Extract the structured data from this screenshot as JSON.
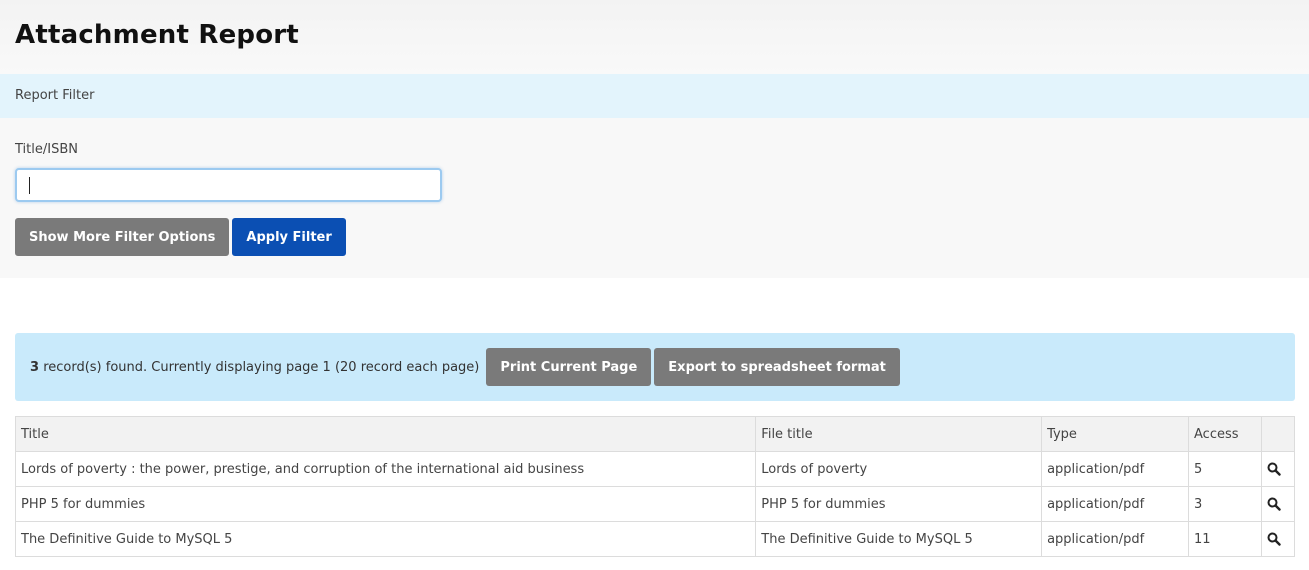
{
  "page": {
    "title": "Attachment Report"
  },
  "filter": {
    "section_label": "Report Filter",
    "field_label": "Title/ISBN",
    "field_value": "",
    "more_options_label": "Show More Filter Options",
    "apply_label": "Apply Filter"
  },
  "results": {
    "count": "3",
    "message": "record(s) found. Currently displaying page 1 (20 record each page)",
    "print_label": "Print Current Page",
    "export_label": "Export to spreadsheet format"
  },
  "table": {
    "headers": [
      "Title",
      "File title",
      "Type",
      "Access",
      ""
    ],
    "rows": [
      {
        "title": "Lords of poverty : the power, prestige, and corruption of the international aid business",
        "file_title": "Lords of poverty",
        "type": "application/pdf",
        "access": "5",
        "action_icon": "search-icon"
      },
      {
        "title": "PHP 5 for dummies",
        "file_title": "PHP 5 for dummies",
        "type": "application/pdf",
        "access": "3",
        "action_icon": "search-icon"
      },
      {
        "title": "The Definitive Guide to MySQL 5",
        "file_title": "The Definitive Guide to MySQL 5",
        "type": "application/pdf",
        "access": "11",
        "action_icon": "search-icon"
      }
    ]
  },
  "colors": {
    "primary_button": "#0b4fb3",
    "secondary_button": "#7a7a7a",
    "filter_bar": "#e3f4fc",
    "records_bar": "#c9eafb"
  }
}
